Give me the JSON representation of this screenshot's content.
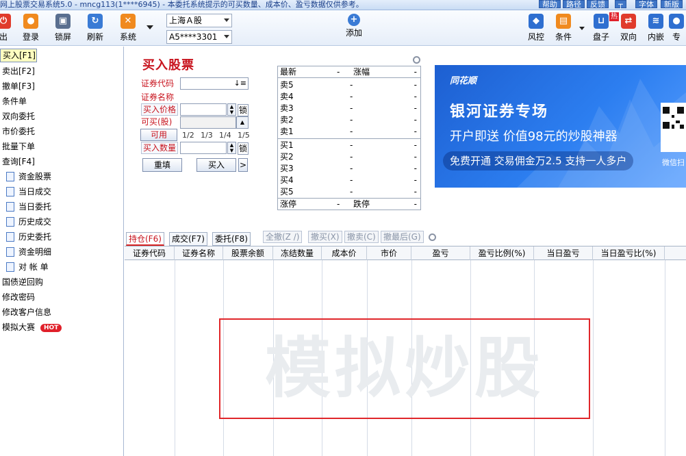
{
  "window": {
    "title": "网上股票交易系统5.0 - mncg113(1****6945) - 本委托系统提示的可买数量、成本价、盈亏数据仅供参考。",
    "buttons": [
      "帮助",
      "路径",
      "反馈",
      "┬",
      "字体",
      "新版"
    ]
  },
  "toolbar": {
    "items": [
      {
        "label": "出",
        "icon": "exit-icon",
        "color": "#e03b2b"
      },
      {
        "label": "登录",
        "icon": "user-icon",
        "color": "#f08a1e"
      },
      {
        "label": "锁屏",
        "icon": "lock-icon",
        "color": "#5a6f8f"
      },
      {
        "label": "刷新",
        "icon": "refresh-icon",
        "color": "#3a7bd5"
      },
      {
        "label": "系统",
        "icon": "tools-icon",
        "color": "#f08a1e"
      }
    ],
    "market_select": "上海Ａ股",
    "account_select": "A5****3301",
    "add_label": "添加",
    "right_items": [
      {
        "label": "风控",
        "icon": "shield-icon"
      },
      {
        "label": "条件",
        "icon": "condition-icon"
      },
      {
        "label": "盘子",
        "icon": "basket-icon",
        "badge": "热"
      },
      {
        "label": "双向",
        "icon": "bidirectional-icon"
      },
      {
        "label": "内嵌",
        "icon": "layers-icon"
      },
      {
        "label": "专",
        "icon": "user-icon"
      }
    ]
  },
  "nav": {
    "items": [
      {
        "label": "买入[F1]",
        "active": true
      },
      {
        "label": "卖出[F2]"
      },
      {
        "label": "撤单[F3]"
      },
      {
        "label": "条件单"
      },
      {
        "label": "双向委托"
      },
      {
        "label": "市价委托"
      },
      {
        "label": "批量下单"
      },
      {
        "label": "查询[F4]"
      }
    ],
    "query_children": [
      "资金股票",
      "当日成交",
      "当日委托",
      "历史成交",
      "历史委托",
      "资金明细",
      "对 帐 单"
    ],
    "bottom_items": [
      "国债逆回购",
      "修改密码",
      "修改客户信息",
      "模拟大赛"
    ],
    "hot_badge": "HOT"
  },
  "order_form": {
    "title": "买入股票",
    "code_label": "证券代码",
    "name_label": "证券名称",
    "price_label": "买入价格",
    "buyable_label": "可买(股)",
    "available_label": "可用",
    "qty_label": "买入数量",
    "lock_label": "锁",
    "fractions": [
      "1/2",
      "1/3",
      "1/4",
      "1/5"
    ],
    "reset_button": "重填",
    "buy_button": "买入",
    "more_button": ">"
  },
  "quote": {
    "header": {
      "last": "最新",
      "last_val": "-",
      "change": "涨幅",
      "change_val": "-"
    },
    "sells": [
      "卖5",
      "卖4",
      "卖3",
      "卖2",
      "卖1"
    ],
    "buys": [
      "买1",
      "买2",
      "买3",
      "买4",
      "买5"
    ],
    "dash": "-",
    "footer": {
      "limit_up": "涨停",
      "limit_up_val": "-",
      "limit_down": "跌停",
      "limit_down_val": "-"
    }
  },
  "ad": {
    "logo": "同花顺",
    "headline": "银河证券专场",
    "subline": "开户即送 价值98元的炒股神器",
    "pill": "免费开通 交易佣金万2.5 支持一人多户",
    "qr_text": "微信扫"
  },
  "tabs": {
    "items": [
      "持仓(F6)",
      "成交(F7)",
      "委托(F8)"
    ],
    "commands": [
      "全撤(Z /)",
      "撤买(X)",
      "撤卖(C)",
      "撤最后(G)"
    ]
  },
  "table": {
    "columns": [
      "证券代码",
      "证券名称",
      "股票余额",
      "冻结数量",
      "成本价",
      "市价",
      "盈亏",
      "盈亏比例(%)",
      "当日盈亏",
      "当日盈亏比(%)"
    ]
  },
  "watermark": "模拟炒股",
  "colors": {
    "accent_red": "#c8141e",
    "ad_blue": "#1d5fd1",
    "selected_nav": "#ffffc0"
  }
}
